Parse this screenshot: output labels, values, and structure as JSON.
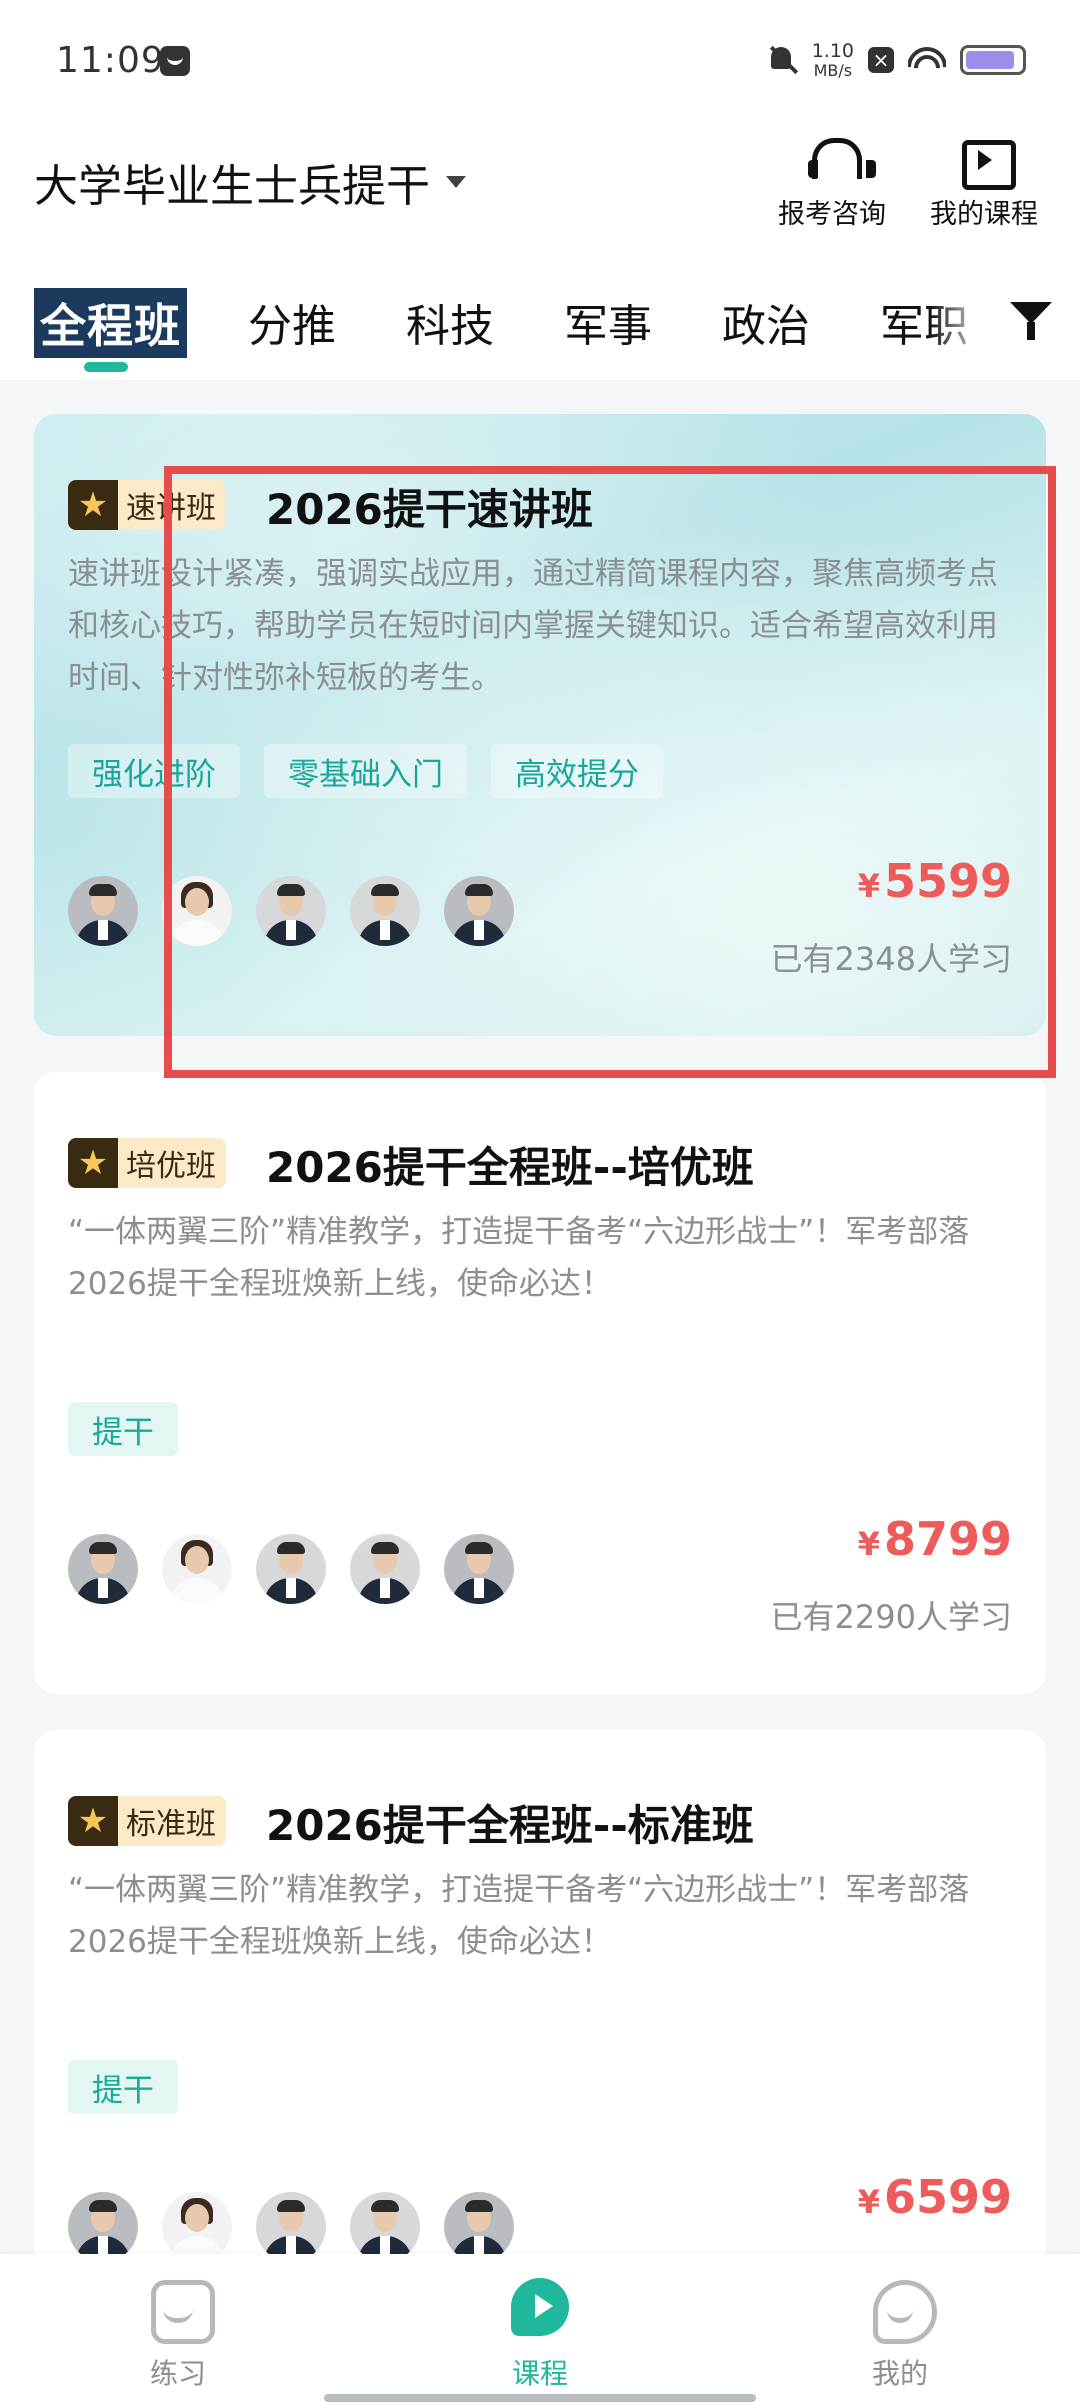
{
  "status_bar": {
    "time": "11:09",
    "speed_value": "1.10",
    "speed_unit": "MB/s",
    "icons": [
      "message-icon",
      "mute-bell-icon",
      "close-box-icon",
      "wifi-icon",
      "battery-icon"
    ]
  },
  "header": {
    "title": "大学毕业生士兵提干",
    "consult_label": "报考咨询",
    "my_courses_label": "我的课程"
  },
  "tabs": [
    "全程班",
    "分推",
    "科技",
    "军事",
    "政治",
    "军职"
  ],
  "active_tab": 0,
  "courses": [
    {
      "badge": "速讲班",
      "title": "2026提干速讲班",
      "description": "速讲班设计紧凑，强调实战应用，通过精简课程内容，聚焦高频考点和核心技巧，帮助学员在短时间内掌握关键知识。适合希望高效利用时间、针对性弥补短板的考生。",
      "tags": [
        "强化进阶",
        "零基础入门",
        "高效提分"
      ],
      "currency": "¥",
      "price": "5599",
      "learners": "已有2348人学习"
    },
    {
      "badge": "培优班",
      "title": "2026提干全程班--培优班",
      "description": "“一体两翼三阶”精准教学，打造提干备考“六边形战士”！军考部落2026提干全程班焕新上线，使命必达！",
      "tags": [
        "提干"
      ],
      "currency": "¥",
      "price": "8799",
      "learners": "已有2290人学习"
    },
    {
      "badge": "标准班",
      "title": "2026提干全程班--标准班",
      "description": "“一体两翼三阶”精准教学，打造提干备考“六边形战士”！军考部落2026提干全程班焕新上线，使命必达！",
      "tags": [
        "提干"
      ],
      "currency": "¥",
      "price": "6599",
      "learners": ""
    }
  ],
  "bottom_nav": {
    "practice": "练习",
    "course": "课程",
    "mine": "我的",
    "active": "course"
  },
  "colors": {
    "accent": "#1fb89c",
    "price": "#ee5b5b",
    "highlight": "#e74c4c",
    "tab_active_bg": "#1c3a5e"
  }
}
